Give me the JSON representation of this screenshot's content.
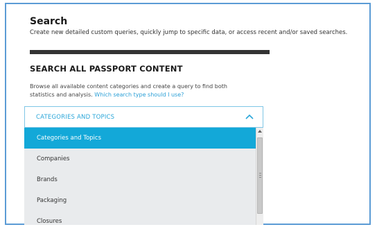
{
  "header": {
    "title": "Search",
    "subtitle": "Create new detailed custom queries, quickly jump to specific data, or access recent and/or saved searches."
  },
  "section": {
    "heading": "SEARCH ALL PASSPORT CONTENT",
    "description": "Browse all available content categories and create a query to find both statistics and analysis.",
    "help_link": "Which search type should I use?"
  },
  "dropdown": {
    "selected_label": "CATEGORIES AND TOPICS",
    "toggle_icon": "chevron-up-icon",
    "options": [
      {
        "label": "Categories and Topics",
        "selected": true
      },
      {
        "label": "Companies",
        "selected": false
      },
      {
        "label": "Brands",
        "selected": false
      },
      {
        "label": "Packaging",
        "selected": false
      },
      {
        "label": "Closures",
        "selected": false
      }
    ]
  },
  "colors": {
    "accent": "#13a8d8",
    "frame_border": "#5b9bd5",
    "rule": "#333333"
  }
}
